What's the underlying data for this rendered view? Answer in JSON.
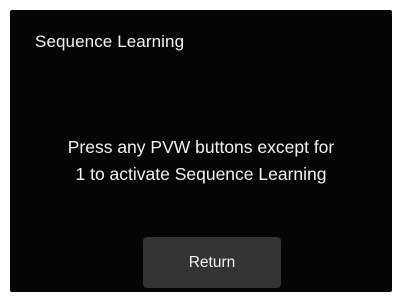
{
  "dialog": {
    "title": "Sequence Learning",
    "message_line1": "Press any PVW buttons except for",
    "message_line2": "1 to activate Sequence Learning",
    "return_label": "Return"
  },
  "colors": {
    "background": "#050505",
    "text": "#f2f2f2",
    "button": "#333333"
  }
}
